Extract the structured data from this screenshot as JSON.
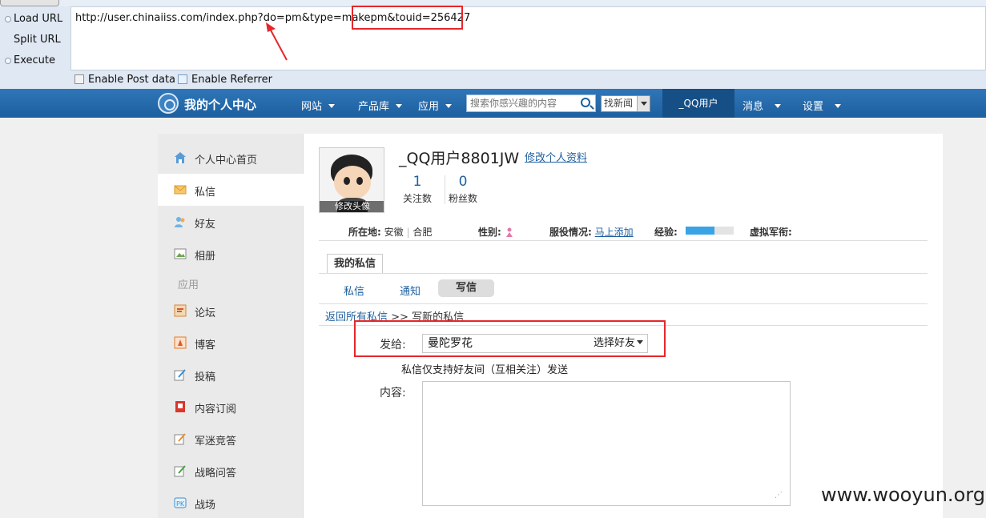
{
  "hackbar": {
    "load_url": "Load URL",
    "split_url": "Split URL",
    "execute": "Execute",
    "url": "http://user.chinaiiss.com/index.php?do=pm&type=makepm&touid=256427",
    "enable_post": "Enable Post data",
    "enable_referrer": "Enable Referrer"
  },
  "nav": {
    "title": "我的个人中心",
    "items": [
      "网站",
      "产品库",
      "应用"
    ],
    "search_placeholder": "搜索你感兴趣的内容",
    "search_scope": "找新闻",
    "user": "_QQ用户",
    "right_items": [
      "消息",
      "设置"
    ]
  },
  "sidebar": {
    "items": [
      "个人中心首页",
      "私信",
      "好友",
      "相册"
    ],
    "section": "应用",
    "apps": [
      "论坛",
      "博客",
      "投稿",
      "内容订阅",
      "军迷竞答",
      "战略问答",
      "战场"
    ]
  },
  "profile": {
    "name": "_QQ用户8801JW",
    "edit_link": "修改个人资料",
    "avatar_caption": "修改头像",
    "follow_count": "1",
    "follow_label": "关注数",
    "fans_count": "0",
    "fans_label": "粉丝数",
    "location_label": "所在地:",
    "location_province": "安徽",
    "location_city": "合肥",
    "gender_label": "性别:",
    "service_label": "服役情况:",
    "service_link": "马上添加",
    "exp_label": "经验:",
    "exp_fraction": 0.6,
    "rank_label": "虚拟军衔:"
  },
  "pm": {
    "tab": "我的私信",
    "subtabs": [
      "私信",
      "通知",
      "写信"
    ],
    "crumb_back": "返回所有私信",
    "crumb_sep": ">>",
    "crumb_current": "写新的私信",
    "to_label": "发给:",
    "to_value": "曼陀罗花",
    "pick_friend": "选择好友",
    "hint": "私信仅支持好友间（互相关注）发送",
    "content_label": "内容:"
  },
  "watermark": "www.wooyun.org"
}
